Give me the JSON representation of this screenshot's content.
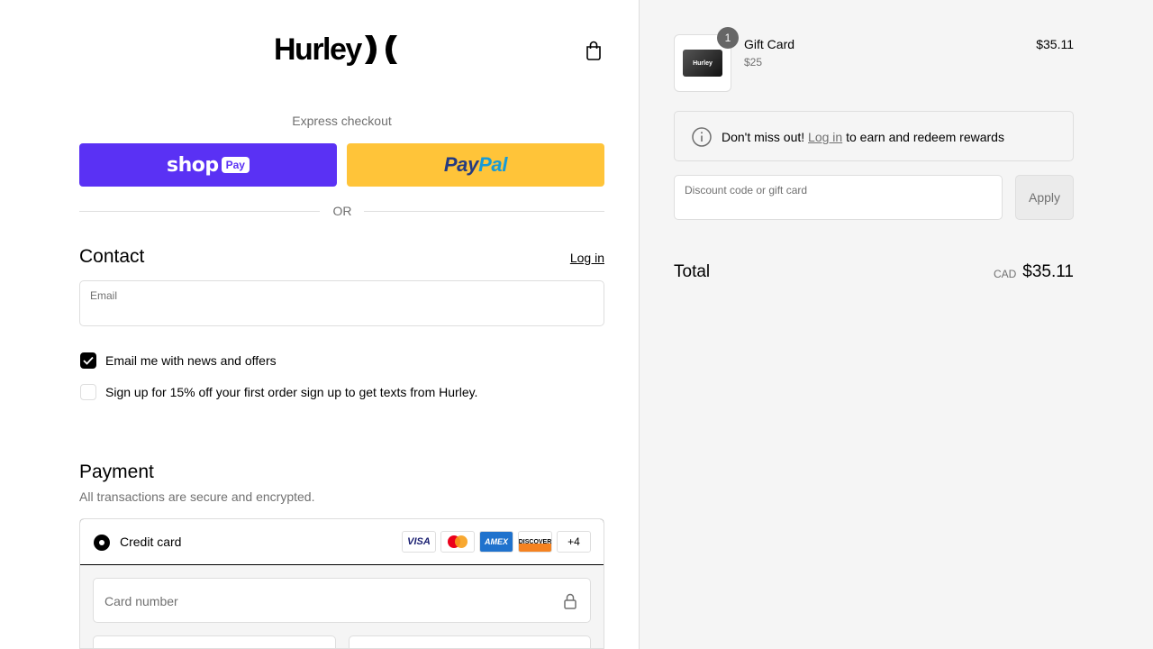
{
  "brand": {
    "logo_text": "Hurley"
  },
  "express": {
    "label": "Express checkout",
    "shop_pay": {
      "word": "shop",
      "pill": "Pay"
    },
    "paypal": {
      "part1": "Pay",
      "part2": "Pal"
    },
    "or_text": "OR"
  },
  "contact": {
    "heading": "Contact",
    "login_link": "Log in",
    "email_label": "Email",
    "checkboxes": [
      {
        "label": "Email me with news and offers",
        "checked": true
      },
      {
        "label": "Sign up for 15% off your first order sign up to get texts from Hurley.",
        "checked": false
      }
    ]
  },
  "payment": {
    "heading": "Payment",
    "subtitle": "All transactions are secure and encrypted.",
    "method_label": "Credit card",
    "brands": [
      "VISA",
      "Mastercard",
      "AMEX",
      "DISCOVER",
      "+4"
    ],
    "card_number_placeholder": "Card number"
  },
  "summary": {
    "item": {
      "name": "Gift Card",
      "variant": "$25",
      "price": "$35.11",
      "quantity": "1",
      "thumb_text": "Hurley"
    },
    "reward": {
      "prefix": "Don't miss out! ",
      "link": "Log in",
      "suffix": " to earn and redeem rewards"
    },
    "discount_label": "Discount code or gift card",
    "apply_label": "Apply",
    "total_label": "Total",
    "currency": "CAD",
    "total_amount": "$35.11"
  },
  "colors": {
    "shop_pay": "#5a31f4",
    "paypal": "#ffc439",
    "summary_bg": "#f5f5f5"
  }
}
